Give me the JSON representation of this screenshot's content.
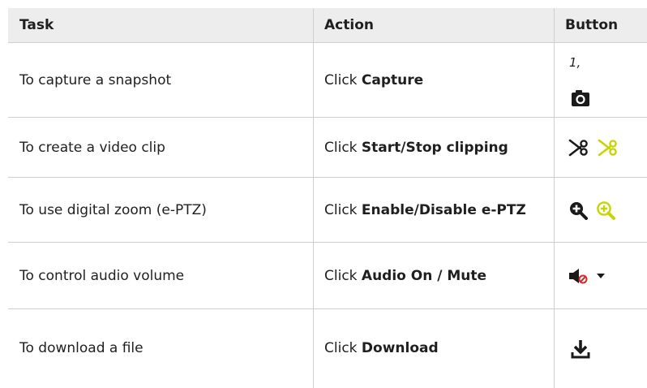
{
  "table": {
    "headers": {
      "task": "Task",
      "action": "Action",
      "button": "Button"
    },
    "rows": [
      {
        "task": "To capture a snapshot",
        "action_prefix": "Click ",
        "action_bold": "Capture",
        "note": "1,",
        "icons": [
          "camera-icon"
        ]
      },
      {
        "task": "To create a video clip",
        "action_prefix": "Click ",
        "action_bold": "Start/Stop clipping",
        "icons": [
          "scissors-icon",
          "scissors-active-icon"
        ]
      },
      {
        "task": "To use digital zoom (e-PTZ)",
        "action_prefix": "Click ",
        "action_bold": "Enable/Disable e-PTZ",
        "icons": [
          "zoom-in-icon",
          "zoom-in-active-icon"
        ]
      },
      {
        "task": "To control audio volume",
        "action_prefix": "Click ",
        "action_bold": "Audio On / Mute",
        "icons": [
          "speaker-muted-icon",
          "dropdown-arrow-icon"
        ]
      },
      {
        "task": "To download a file",
        "action_prefix": "Click ",
        "action_bold": "Download",
        "icons": [
          "download-icon"
        ]
      }
    ]
  },
  "colors": {
    "header_bg": "#ededed",
    "border": "#cfcfcf",
    "icon_dark": "#1a1a1a",
    "icon_active": "#c8d400",
    "mute_red": "#d62828"
  }
}
